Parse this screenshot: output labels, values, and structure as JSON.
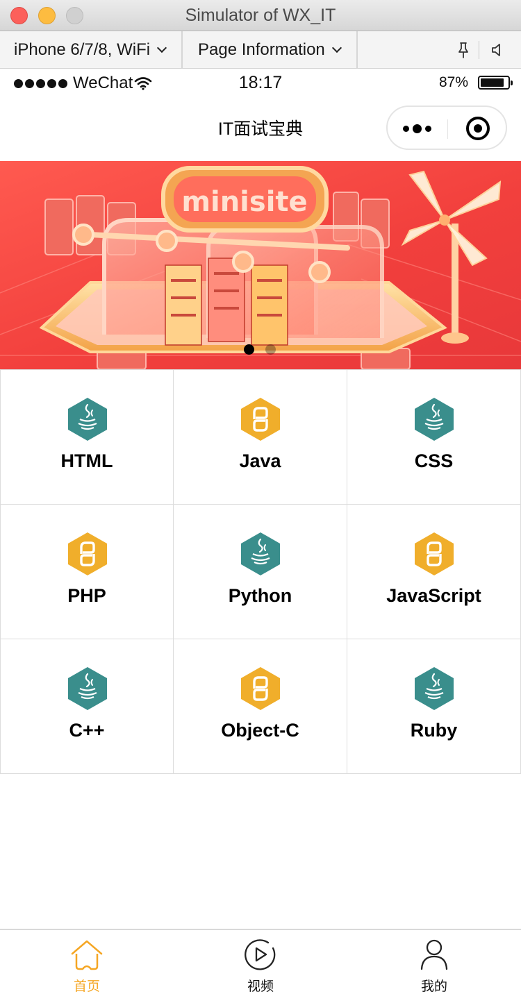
{
  "window": {
    "title": "Simulator of WX_IT"
  },
  "toolbar": {
    "device_label": "iPhone 6/7/8, WiFi",
    "page_info_label": "Page Information",
    "pin_icon": "pin-icon",
    "sound_icon": "speaker-icon"
  },
  "status_bar": {
    "carrier": "WeChat",
    "time": "18:17",
    "battery_percent": "87%",
    "battery_level": 0.87
  },
  "nav": {
    "title": "IT面试宝典"
  },
  "banner": {
    "text": "minisite",
    "slide_count": 2,
    "active_slide": 0
  },
  "grid": {
    "items": [
      {
        "label": "HTML",
        "icon": "java-icon"
      },
      {
        "label": "Java",
        "icon": "python-icon"
      },
      {
        "label": "CSS",
        "icon": "java-icon"
      },
      {
        "label": "PHP",
        "icon": "python-icon"
      },
      {
        "label": "Python",
        "icon": "java-icon"
      },
      {
        "label": "JavaScript",
        "icon": "python-icon"
      },
      {
        "label": "C++",
        "icon": "java-icon"
      },
      {
        "label": "Object-C",
        "icon": "python-icon"
      },
      {
        "label": "Ruby",
        "icon": "java-icon"
      }
    ]
  },
  "tabbar": {
    "items": [
      {
        "label": "首页",
        "icon": "home-icon",
        "active": true
      },
      {
        "label": "视频",
        "icon": "play-icon",
        "active": false
      },
      {
        "label": "我的",
        "icon": "user-icon",
        "active": false
      }
    ]
  },
  "colors": {
    "accent": "#f5a623",
    "teal_icon": "#3a8e8c",
    "yellow_icon": "#f0ae2b",
    "banner_red": "#f2403d"
  }
}
